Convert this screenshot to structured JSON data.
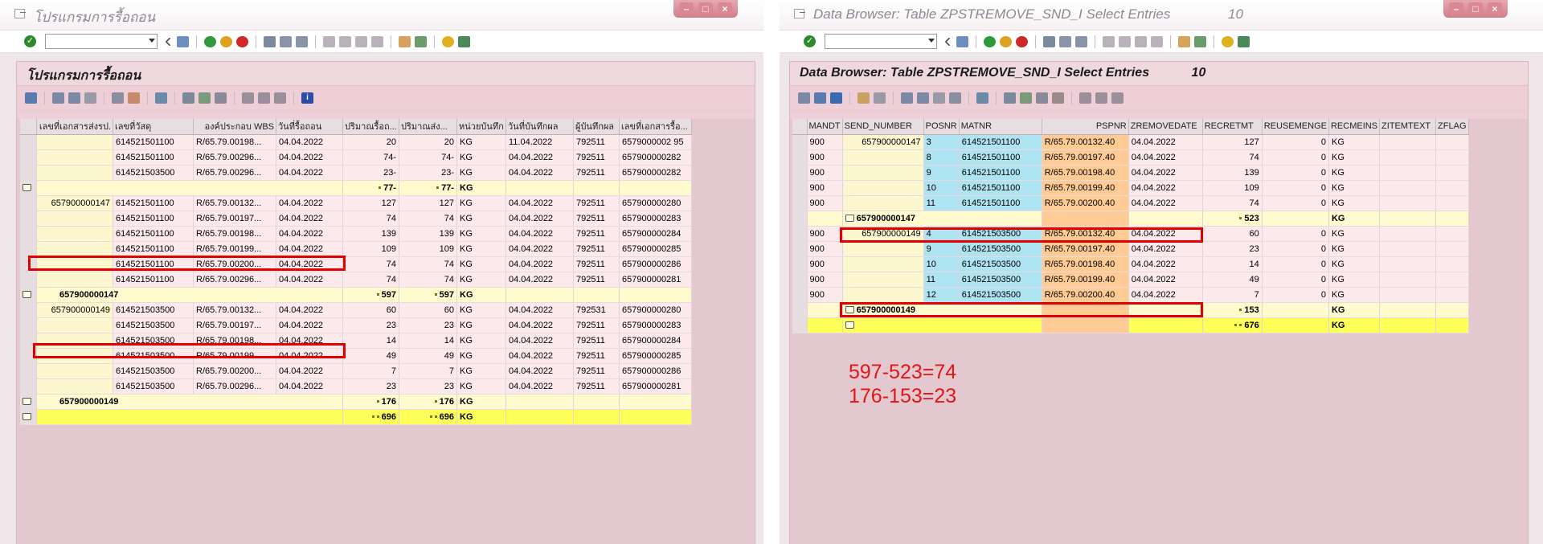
{
  "left": {
    "window_title": "โปรแกรมการรื้อถอน",
    "panel_title": "โปรแกรมการรื้อถอน",
    "columns": [
      "เลขที่เอกสารส่งรป.",
      "เลขที่วัสดุ",
      "องค์ประกอบ WBS",
      "วันที่รื้อถอน",
      "ปริมาณรื้อถ...",
      "ปริมาณส่ง...",
      "หน่วยบันทึก",
      "วันที่บันทึกผล",
      "ผู้บันทึกผล",
      "เลขที่เอกสารรื้อ..."
    ],
    "rows": [
      {
        "type": "data",
        "doc": "",
        "mat": "614521501100",
        "wbs": "R/65.79.00198...",
        "date": "04.04.2022",
        "qty1": "20",
        "qty2": "20",
        "unit": "KG",
        "rdate": "11.04.2022",
        "user": "792511",
        "rdoc": "6579000002 95"
      },
      {
        "type": "data",
        "doc": "",
        "mat": "614521501100",
        "wbs": "R/65.79.00296...",
        "date": "04.04.2022",
        "qty1": "74-",
        "qty2": "74-",
        "unit": "KG",
        "rdate": "04.04.2022",
        "user": "792511",
        "rdoc": "657900000282"
      },
      {
        "type": "data",
        "doc": "",
        "mat": "614521503500",
        "wbs": "R/65.79.00296...",
        "date": "04.04.2022",
        "qty1": "23-",
        "qty2": "23-",
        "unit": "KG",
        "rdate": "04.04.2022",
        "user": "792511",
        "rdoc": "657900000282"
      },
      {
        "type": "sub",
        "doc": "",
        "qty1": "77-",
        "qty2": "77-",
        "unit": "KG"
      },
      {
        "type": "data",
        "doc": "657900000147",
        "mat": "614521501100",
        "wbs": "R/65.79.00132...",
        "date": "04.04.2022",
        "qty1": "127",
        "qty2": "127",
        "unit": "KG",
        "rdate": "04.04.2022",
        "user": "792511",
        "rdoc": "657900000280"
      },
      {
        "type": "data",
        "doc": "",
        "mat": "614521501100",
        "wbs": "R/65.79.00197...",
        "date": "04.04.2022",
        "qty1": "74",
        "qty2": "74",
        "unit": "KG",
        "rdate": "04.04.2022",
        "user": "792511",
        "rdoc": "657900000283"
      },
      {
        "type": "data",
        "doc": "",
        "mat": "614521501100",
        "wbs": "R/65.79.00198...",
        "date": "04.04.2022",
        "qty1": "139",
        "qty2": "139",
        "unit": "KG",
        "rdate": "04.04.2022",
        "user": "792511",
        "rdoc": "657900000284"
      },
      {
        "type": "data",
        "doc": "",
        "mat": "614521501100",
        "wbs": "R/65.79.00199...",
        "date": "04.04.2022",
        "qty1": "109",
        "qty2": "109",
        "unit": "KG",
        "rdate": "04.04.2022",
        "user": "792511",
        "rdoc": "657900000285"
      },
      {
        "type": "data",
        "doc": "",
        "mat": "614521501100",
        "wbs": "R/65.79.00200...",
        "date": "04.04.2022",
        "qty1": "74",
        "qty2": "74",
        "unit": "KG",
        "rdate": "04.04.2022",
        "user": "792511",
        "rdoc": "657900000286"
      },
      {
        "type": "data",
        "doc": "",
        "mat": "614521501100",
        "wbs": "R/65.79.00296...",
        "date": "04.04.2022",
        "qty1": "74",
        "qty2": "74",
        "unit": "KG",
        "rdate": "04.04.2022",
        "user": "792511",
        "rdoc": "657900000281"
      },
      {
        "type": "sub",
        "doc": "657900000147",
        "qty1": "597",
        "qty2": "597",
        "unit": "KG"
      },
      {
        "type": "data",
        "doc": "657900000149",
        "mat": "614521503500",
        "wbs": "R/65.79.00132...",
        "date": "04.04.2022",
        "qty1": "60",
        "qty2": "60",
        "unit": "KG",
        "rdate": "04.04.2022",
        "user": "792531",
        "rdoc": "657900000280"
      },
      {
        "type": "data",
        "doc": "",
        "mat": "614521503500",
        "wbs": "R/65.79.00197...",
        "date": "04.04.2022",
        "qty1": "23",
        "qty2": "23",
        "unit": "KG",
        "rdate": "04.04.2022",
        "user": "792511",
        "rdoc": "657900000283"
      },
      {
        "type": "data",
        "doc": "",
        "mat": "614521503500",
        "wbs": "R/65.79.00198...",
        "date": "04.04.2022",
        "qty1": "14",
        "qty2": "14",
        "unit": "KG",
        "rdate": "04.04.2022",
        "user": "792511",
        "rdoc": "657900000284"
      },
      {
        "type": "data",
        "doc": "",
        "mat": "614521503500",
        "wbs": "R/65.79.00199...",
        "date": "04.04.2022",
        "qty1": "49",
        "qty2": "49",
        "unit": "KG",
        "rdate": "04.04.2022",
        "user": "792511",
        "rdoc": "657900000285"
      },
      {
        "type": "data",
        "doc": "",
        "mat": "614521503500",
        "wbs": "R/65.79.00200...",
        "date": "04.04.2022",
        "qty1": "7",
        "qty2": "7",
        "unit": "KG",
        "rdate": "04.04.2022",
        "user": "792511",
        "rdoc": "657900000286"
      },
      {
        "type": "data",
        "doc": "",
        "mat": "614521503500",
        "wbs": "R/65.79.00296...",
        "date": "04.04.2022",
        "qty1": "23",
        "qty2": "23",
        "unit": "KG",
        "rdate": "04.04.2022",
        "user": "792511",
        "rdoc": "657900000281"
      },
      {
        "type": "sub",
        "doc": "657900000149",
        "qty1": "176",
        "qty2": "176",
        "unit": "KG"
      },
      {
        "type": "tot",
        "doc": "",
        "qty1": "696",
        "qty2": "696",
        "unit": "KG"
      }
    ]
  },
  "right": {
    "window_title": "Data Browser: Table ZPSTREMOVE_SND_I Select Entries",
    "window_count": "10",
    "panel_title": "Data Browser: Table ZPSTREMOVE_SND_I Select Entries",
    "panel_count": "10",
    "columns": [
      "MANDT",
      "SEND_NUMBER",
      "POSNR",
      "MATNR",
      "PSPNR",
      "ZREMOVEDATE",
      "RECRETMT",
      "REUSEMENGE",
      "RECMEINS",
      "ZITEMTEXT",
      "ZFLAG"
    ],
    "rows": [
      {
        "type": "data",
        "mandt": "900",
        "send": "657900000147",
        "posnr": "3",
        "matnr": "614521501100",
        "pspnr": "R/65.79.00132.40",
        "date": "04.04.2022",
        "recret": "127",
        "reuse": "0",
        "unit": "KG"
      },
      {
        "type": "data",
        "mandt": "900",
        "send": "",
        "posnr": "8",
        "matnr": "614521501100",
        "pspnr": "R/65.79.00197.40",
        "date": "04.04.2022",
        "recret": "74",
        "reuse": "0",
        "unit": "KG"
      },
      {
        "type": "data",
        "mandt": "900",
        "send": "",
        "posnr": "9",
        "matnr": "614521501100",
        "pspnr": "R/65.79.00198.40",
        "date": "04.04.2022",
        "recret": "139",
        "reuse": "0",
        "unit": "KG"
      },
      {
        "type": "data",
        "mandt": "900",
        "send": "",
        "posnr": "10",
        "matnr": "614521501100",
        "pspnr": "R/65.79.00199.40",
        "date": "04.04.2022",
        "recret": "109",
        "reuse": "0",
        "unit": "KG"
      },
      {
        "type": "data",
        "mandt": "900",
        "send": "",
        "posnr": "11",
        "matnr": "614521501100",
        "pspnr": "R/65.79.00200.40",
        "date": "04.04.2022",
        "recret": "74",
        "reuse": "0",
        "unit": "KG"
      },
      {
        "type": "sub",
        "send": "657900000147",
        "recret": "523",
        "unit": "KG"
      },
      {
        "type": "data",
        "mandt": "900",
        "send": "657900000149",
        "posnr": "4",
        "matnr": "614521503500",
        "pspnr": "R/65.79.00132.40",
        "date": "04.04.2022",
        "recret": "60",
        "reuse": "0",
        "unit": "KG"
      },
      {
        "type": "data",
        "mandt": "900",
        "send": "",
        "posnr": "9",
        "matnr": "614521503500",
        "pspnr": "R/65.79.00197.40",
        "date": "04.04.2022",
        "recret": "23",
        "reuse": "0",
        "unit": "KG"
      },
      {
        "type": "data",
        "mandt": "900",
        "send": "",
        "posnr": "10",
        "matnr": "614521503500",
        "pspnr": "R/65.79.00198.40",
        "date": "04.04.2022",
        "recret": "14",
        "reuse": "0",
        "unit": "KG"
      },
      {
        "type": "data",
        "mandt": "900",
        "send": "",
        "posnr": "11",
        "matnr": "614521503500",
        "pspnr": "R/65.79.00199.40",
        "date": "04.04.2022",
        "recret": "49",
        "reuse": "0",
        "unit": "KG"
      },
      {
        "type": "data",
        "mandt": "900",
        "send": "",
        "posnr": "12",
        "matnr": "614521503500",
        "pspnr": "R/65.79.00200.40",
        "date": "04.04.2022",
        "recret": "7",
        "reuse": "0",
        "unit": "KG"
      },
      {
        "type": "sub",
        "send": "657900000149",
        "recret": "153",
        "unit": "KG"
      },
      {
        "type": "tot",
        "send": "",
        "recret": "676",
        "unit": "KG"
      }
    ]
  },
  "annotations": [
    "597-523=74",
    "176-153=23"
  ],
  "colors": {
    "highlight": "#e00000",
    "annotation": "#e41515",
    "subtotal_row": "#fffbcf",
    "total_row": "#ffff5a"
  }
}
